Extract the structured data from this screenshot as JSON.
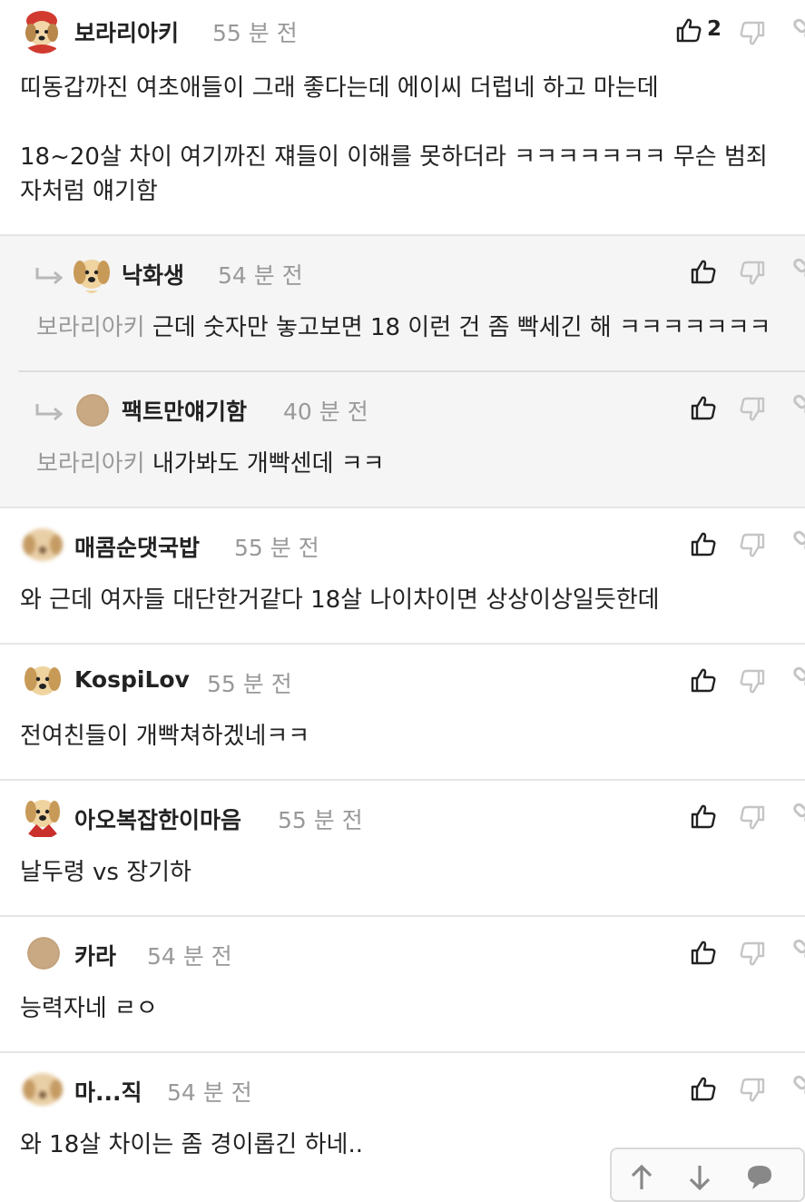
{
  "comments": [
    {
      "author": "보라리아키",
      "time": "55 분 전",
      "likes": "2",
      "avatar": "dog-red-hood",
      "text": "띠동갑까진 여초애들이 그래 좋다는데 에이씨 더럽네 하고 마는데\n\n18~20살 차이 여기까진 쟤들이 이해를 못하더라 ㅋㅋㅋㅋㅋㅋㅋ 무슨 범죄\n자처럼 얘기함"
    },
    {
      "author": "낙화생",
      "time": "54 분 전",
      "avatar": "dog-face",
      "mention": "보라리아키",
      "text": "근데 숫자만 놓고보면 18 이런 건 좀 빡세긴 해 ㅋㅋㅋㅋㅋㅋㅋ"
    },
    {
      "author": "팩트만얘기함",
      "time": "40 분 전",
      "avatar": "plain-circle",
      "mention": "보라리아키",
      "text": "내가봐도 개빡센데 ㅋㅋ"
    },
    {
      "author": "매콤순댓국밥",
      "time": "55 분 전",
      "avatar": "blurred-dog",
      "text": "와 근데 여자들 대단한거같다 18살 나이차이면 상상이상일듯한데"
    },
    {
      "author": "KospiLov",
      "time": "55 분 전",
      "avatar": "dog-face",
      "text": "전여친들이 개빡쳐하겠네ㅋㅋ"
    },
    {
      "author": "아오복잡한이마음",
      "time": "55 분 전",
      "avatar": "dog-red-cape",
      "text": "날두령 vs 장기하"
    },
    {
      "author": "카라",
      "time": "54 분 전",
      "avatar": "plain-circle",
      "text": "능력자네 ㄹㅇ"
    },
    {
      "author": "마...직",
      "time": "54 분 전",
      "avatar": "blurred-dog",
      "text": "와 18살 차이는 좀 경이롭긴 하네.."
    }
  ],
  "icons": {
    "like": "thumbs-up-icon",
    "dislike": "thumbs-down-icon",
    "share": "link-icon",
    "reply": "reply-arrow-icon",
    "scroll_up": "arrow-up-icon",
    "scroll_down": "arrow-down-icon",
    "comment": "speech-bubble-icon"
  },
  "colors": {
    "reply_bg": "#f5f5f5",
    "divider": "#e6e6e6",
    "meta_gray": "#999999",
    "mention_gray": "#9a9a9a"
  }
}
